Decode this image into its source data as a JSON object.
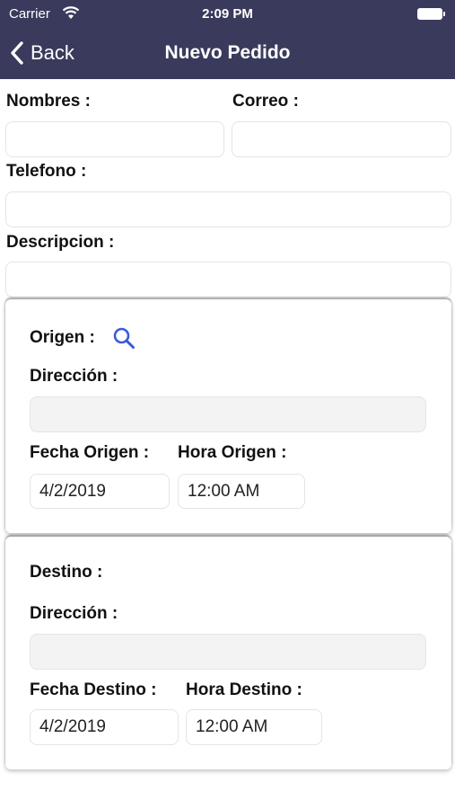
{
  "status_bar": {
    "carrier": "Carrier",
    "time": "2:09 PM"
  },
  "navbar": {
    "back_label": "Back",
    "title": "Nuevo Pedido"
  },
  "form": {
    "nombres_label": "Nombres :",
    "nombres_value": "",
    "correo_label": "Correo :",
    "correo_value": "",
    "telefono_label": "Telefono :",
    "telefono_value": "",
    "descripcion_label": "Descripcion :",
    "descripcion_value": ""
  },
  "origen": {
    "title": "Origen :",
    "direccion_label": "Dirección :",
    "direccion_value": "",
    "fecha_label": "Fecha Origen :",
    "fecha_value": "4/2/2019",
    "hora_label": "Hora Origen :",
    "hora_value": "12:00 AM"
  },
  "destino": {
    "title": "Destino :",
    "direccion_label": "Dirección :",
    "direccion_value": "",
    "fecha_label": "Fecha Destino :",
    "fecha_value": "4/2/2019",
    "hora_label": "Hora Destino :",
    "hora_value": "12:00 AM"
  },
  "icons": {
    "search": "search-icon",
    "back": "chevron-left-icon",
    "wifi": "wifi-icon",
    "battery": "battery-icon"
  },
  "colors": {
    "header_bg": "#3a3a5c",
    "search_icon": "#3b5bdb"
  }
}
